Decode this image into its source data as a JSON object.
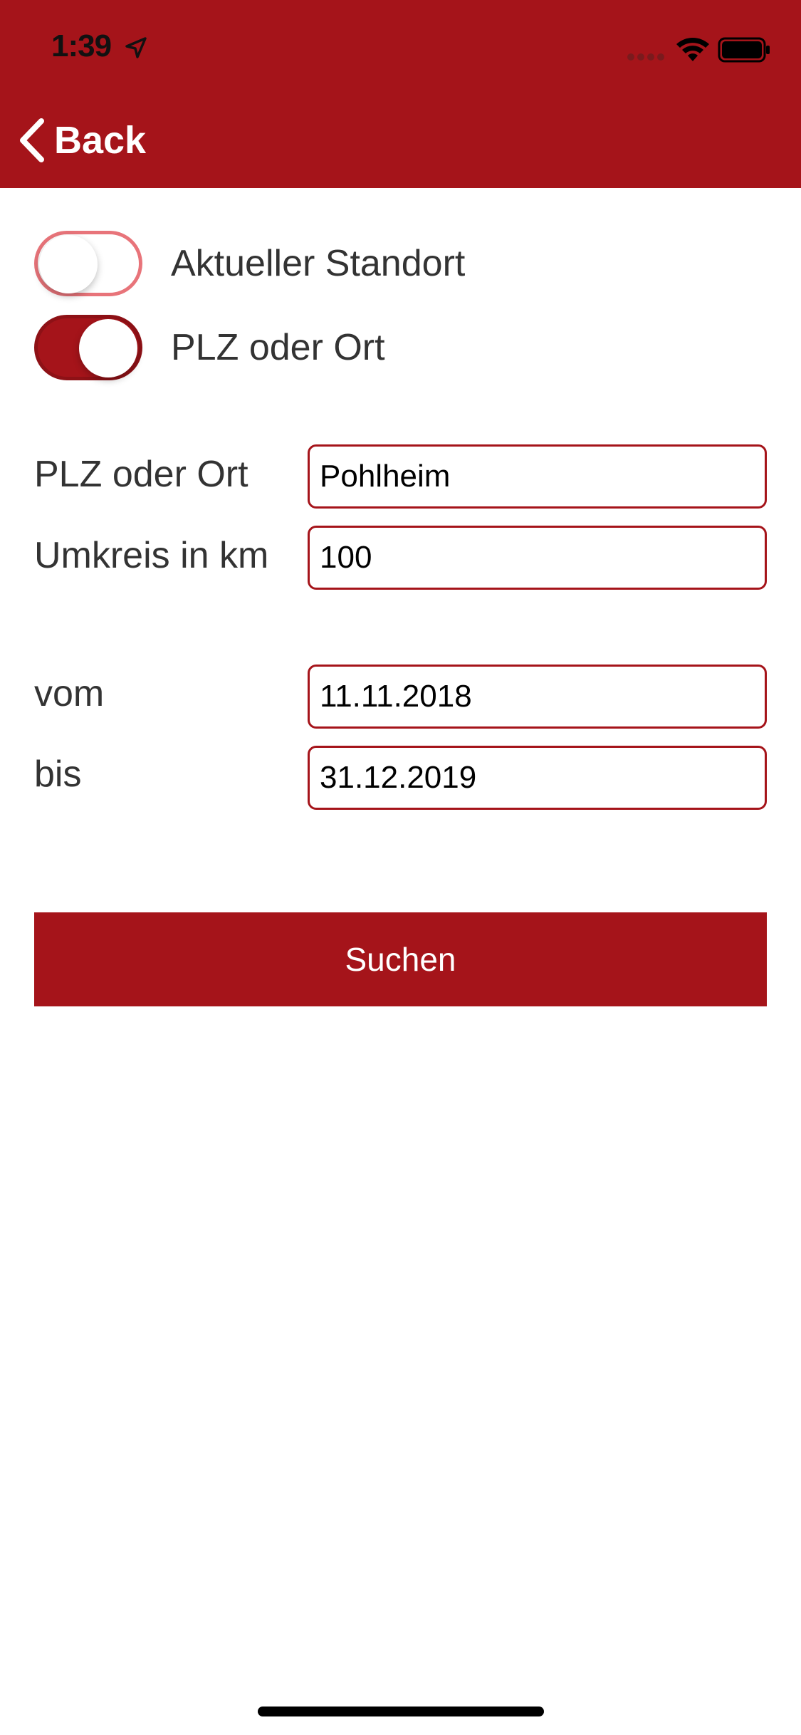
{
  "status_bar": {
    "time": "1:39"
  },
  "nav": {
    "back_label": "Back"
  },
  "toggles": [
    {
      "label": "Aktueller Standort",
      "checked": false
    },
    {
      "label": "PLZ oder Ort",
      "checked": true
    }
  ],
  "form": {
    "location": {
      "label": "PLZ oder Ort",
      "value": "Pohlheim"
    },
    "radius": {
      "label": "Umkreis in km",
      "value": "100"
    },
    "from": {
      "label": "vom",
      "value": "11.11.2018"
    },
    "to": {
      "label": "bis",
      "value": "31.12.2019"
    }
  },
  "search_button": {
    "label": "Suchen"
  },
  "colors": {
    "accent": "#a5141a",
    "toggle_off_border": "#e8747a",
    "text": "#333333"
  },
  "icons": {
    "location": "location-arrow-icon",
    "signal": "cellular-signal-icon",
    "wifi": "wifi-icon",
    "battery": "battery-icon",
    "back": "chevron-left-icon"
  }
}
